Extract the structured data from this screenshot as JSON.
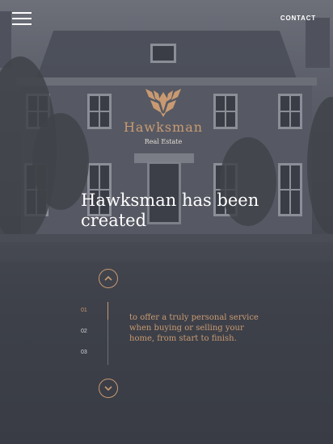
{
  "header": {
    "menu_icon": "hamburger-icon",
    "contact_label": "CONTACT"
  },
  "logo": {
    "icon": "hawk-emblem-icon",
    "brand": "Hawksman",
    "tagline": "Real Estate"
  },
  "hero": {
    "headline": "Hawksman has been created"
  },
  "slider": {
    "up_icon": "chevron-up-icon",
    "down_icon": "chevron-down-icon",
    "steps": [
      "01",
      "02",
      "03"
    ],
    "active_step": "01",
    "description": "to offer a truly personal service when buying or selling your home, from start to finish."
  },
  "colors": {
    "accent": "#c99a72",
    "text": "#ffffff",
    "background": "#393c45"
  }
}
